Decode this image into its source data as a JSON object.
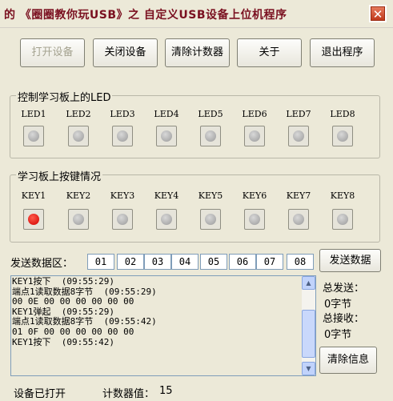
{
  "window": {
    "title": "的 《圈圈教你玩USB》之 自定义USB设备上位机程序",
    "close_glyph": "✕"
  },
  "toolbar": {
    "open_label": "打开设备",
    "close_label": "关闭设备",
    "clear_counter_label": "清除计数器",
    "about_label": "关于",
    "exit_label": "退出程序"
  },
  "led_group": {
    "title": "控制学习板上的LED",
    "labels": [
      "LED1",
      "LED2",
      "LED3",
      "LED4",
      "LED5",
      "LED6",
      "LED7",
      "LED8"
    ]
  },
  "key_group": {
    "title": "学习板上按键情况",
    "labels": [
      "KEY1",
      "KEY2",
      "KEY3",
      "KEY4",
      "KEY5",
      "KEY6",
      "KEY7",
      "KEY8"
    ],
    "pressed": [
      true,
      false,
      false,
      false,
      false,
      false,
      false,
      false
    ]
  },
  "send": {
    "label": "发送数据区：",
    "bytes": [
      "01",
      "02",
      "03",
      "04",
      "05",
      "06",
      "07",
      "08"
    ],
    "button_label": "发送数据"
  },
  "log": {
    "lines": [
      "KEY1按下  (09:55:29)",
      "端点1读取数据8字节  (09:55:29)",
      "00 0E 00 00 00 00 00 00",
      "KEY1弹起  (09:55:29)",
      "端点1读取数据8字节  (09:55:42)",
      "01 0F 00 00 00 00 00 00",
      "KEY1按下  (09:55:42)"
    ]
  },
  "stats": {
    "total_sent_label": "总发送：",
    "total_sent_value": "0字节",
    "total_recv_label": "总接收：",
    "total_recv_value": "0字节",
    "clear_info_label": "清除信息"
  },
  "status": {
    "device_state": "设备已打开",
    "counter_label": "计数器值：",
    "counter_value": "15"
  },
  "colors": {
    "title_text": "#7a1020",
    "led_on": "#e00000"
  }
}
